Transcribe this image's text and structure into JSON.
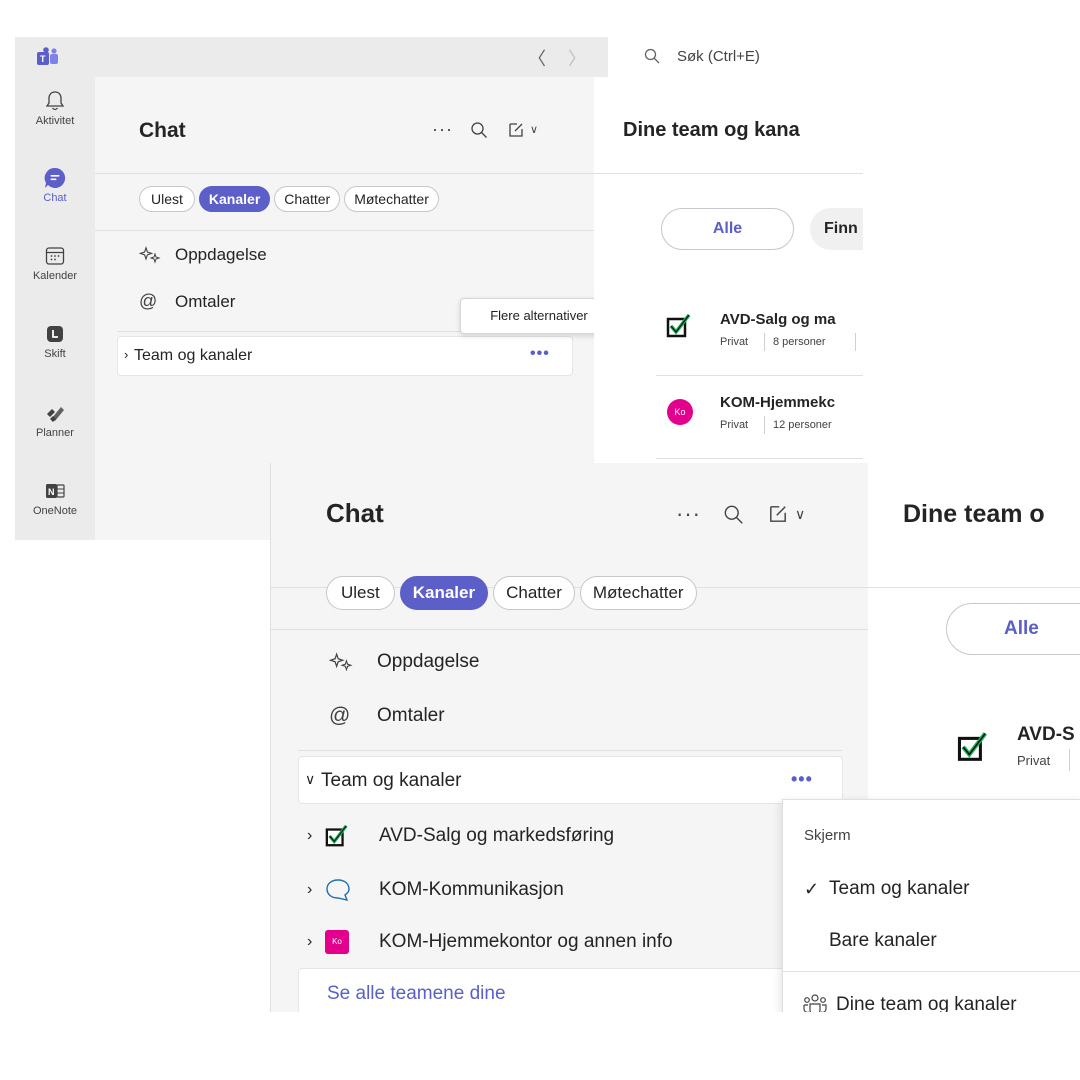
{
  "back": {
    "titlebar": {
      "search_placeholder": "Søk (Ctrl+E)"
    },
    "rail": [
      {
        "label": "Aktivitet",
        "icon": "bell-icon"
      },
      {
        "label": "Chat",
        "icon": "chat-icon",
        "active": true
      },
      {
        "label": "Kalender",
        "icon": "calendar-icon"
      },
      {
        "label": "Skift",
        "icon": "shifts-icon"
      },
      {
        "label": "Planner",
        "icon": "planner-icon"
      },
      {
        "label": "OneNote",
        "icon": "onenote-icon"
      }
    ],
    "chat_title": "Chat",
    "filters": [
      "Ulest",
      "Kanaler",
      "Chatter",
      "Møtechatter"
    ],
    "active_filter": "Kanaler",
    "items": {
      "discover": "Oppdagelse",
      "mentions": "Omtaler"
    },
    "teams_section": "Team og kanaler",
    "tooltip": "Flere alternativer",
    "right": {
      "title": "Dine team og kana",
      "tab_all": "Alle",
      "tab_find": "Finn",
      "teams": [
        {
          "name": "AVD-Salg og ma",
          "privacy": "Privat",
          "members": "8 personer"
        },
        {
          "name": "KOM-Hjemmekc",
          "privacy": "Privat",
          "members": "12 personer",
          "avatar": "Ko"
        }
      ]
    }
  },
  "front": {
    "chat_title": "Chat",
    "filters": [
      "Ulest",
      "Kanaler",
      "Chatter",
      "Møtechatter"
    ],
    "items": {
      "discover": "Oppdagelse",
      "mentions": "Omtaler"
    },
    "teams_section": "Team og kanaler",
    "teams": [
      {
        "name": "AVD-Salg og markedsføring",
        "icon": "checkbox-logo-icon"
      },
      {
        "name": "KOM-Kommunikasjon",
        "icon": "speech-bubble-icon"
      },
      {
        "name": "KOM-Hjemmekontor og annen info",
        "icon": "avatar-ko-icon",
        "avatar": "Ko"
      }
    ],
    "see_all": "Se alle teamene dine",
    "right": {
      "title": "Dine team o",
      "tab_all": "Alle",
      "team_name": "AVD-S",
      "team_privacy": "Privat"
    },
    "menu": {
      "header": "Skjerm",
      "option_teams_channels": "Team og kanaler",
      "option_only_channels": "Bare kanaler",
      "your_teams": "Dine team og kanaler"
    }
  },
  "colors": {
    "accent": "#5b5fc7",
    "pink_avatar": "#e3008c",
    "rail_bg": "#ebebeb"
  }
}
